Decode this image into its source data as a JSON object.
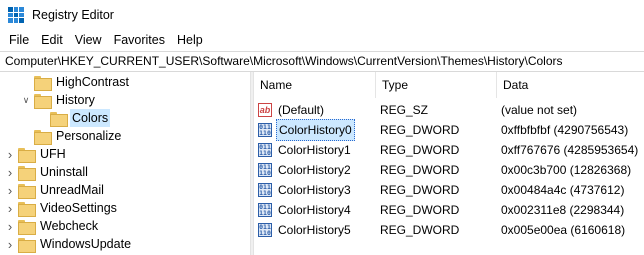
{
  "window": {
    "title": "Registry Editor"
  },
  "menu": [
    "File",
    "Edit",
    "View",
    "Favorites",
    "Help"
  ],
  "address": "Computer\\HKEY_CURRENT_USER\\Software\\Microsoft\\Windows\\CurrentVersion\\Themes\\History\\Colors",
  "tree": [
    {
      "label": "HighContrast",
      "level": 1,
      "expanded": null,
      "selected": false
    },
    {
      "label": "History",
      "level": 1,
      "expanded": true,
      "selected": false
    },
    {
      "label": "Colors",
      "level": 2,
      "expanded": null,
      "selected": true
    },
    {
      "label": "Personalize",
      "level": 1,
      "expanded": null,
      "selected": false
    },
    {
      "label": "UFH",
      "level": 0,
      "expanded": false,
      "selected": false
    },
    {
      "label": "Uninstall",
      "level": 0,
      "expanded": false,
      "selected": false
    },
    {
      "label": "UnreadMail",
      "level": 0,
      "expanded": false,
      "selected": false
    },
    {
      "label": "VideoSettings",
      "level": 0,
      "expanded": false,
      "selected": false
    },
    {
      "label": "Webcheck",
      "level": 0,
      "expanded": false,
      "selected": false
    },
    {
      "label": "WindowsUpdate",
      "level": 0,
      "expanded": false,
      "selected": false
    }
  ],
  "list": {
    "columns": [
      "Name",
      "Type",
      "Data"
    ],
    "rows": [
      {
        "icon": "string-value-icon",
        "name": "(Default)",
        "type": "REG_SZ",
        "data": "(value not set)",
        "selected": false
      },
      {
        "icon": "dword-value-icon",
        "name": "ColorHistory0",
        "type": "REG_DWORD",
        "data": "0xffbfbfbf (4290756543)",
        "selected": true
      },
      {
        "icon": "dword-value-icon",
        "name": "ColorHistory1",
        "type": "REG_DWORD",
        "data": "0xff767676 (4285953654)",
        "selected": false
      },
      {
        "icon": "dword-value-icon",
        "name": "ColorHistory2",
        "type": "REG_DWORD",
        "data": "0x00c3b700 (12826368)",
        "selected": false
      },
      {
        "icon": "dword-value-icon",
        "name": "ColorHistory3",
        "type": "REG_DWORD",
        "data": "0x00484a4c (4737612)",
        "selected": false
      },
      {
        "icon": "dword-value-icon",
        "name": "ColorHistory4",
        "type": "REG_DWORD",
        "data": "0x002311e8 (2298344)",
        "selected": false
      },
      {
        "icon": "dword-value-icon",
        "name": "ColorHistory5",
        "type": "REG_DWORD",
        "data": "0x005e00ea (6160618)",
        "selected": false
      }
    ]
  },
  "colors": {
    "selection": "#cce8ff",
    "folder": "#f5d27a",
    "accent": "#2b6bd0"
  }
}
